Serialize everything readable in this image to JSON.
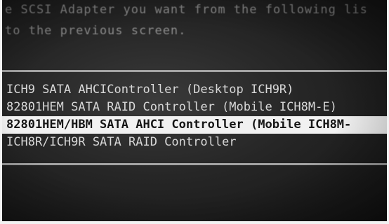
{
  "header": {
    "line1": "e SCSI Adapter you want from the following lis",
    "line2": " to the previous screen."
  },
  "adapters": [
    {
      "label": "ICH9 SATA AHCIController (Desktop ICH9R)",
      "selected": false
    },
    {
      "label": "82801HEM SATA RAID Controller (Mobile ICH8M-E)",
      "selected": false
    },
    {
      "label": "82801HEM/HBM SATA AHCI Controller (Mobile ICH8M-",
      "selected": true
    },
    {
      "label": "ICH8R/ICH9R SATA RAID Controller",
      "selected": false
    }
  ]
}
